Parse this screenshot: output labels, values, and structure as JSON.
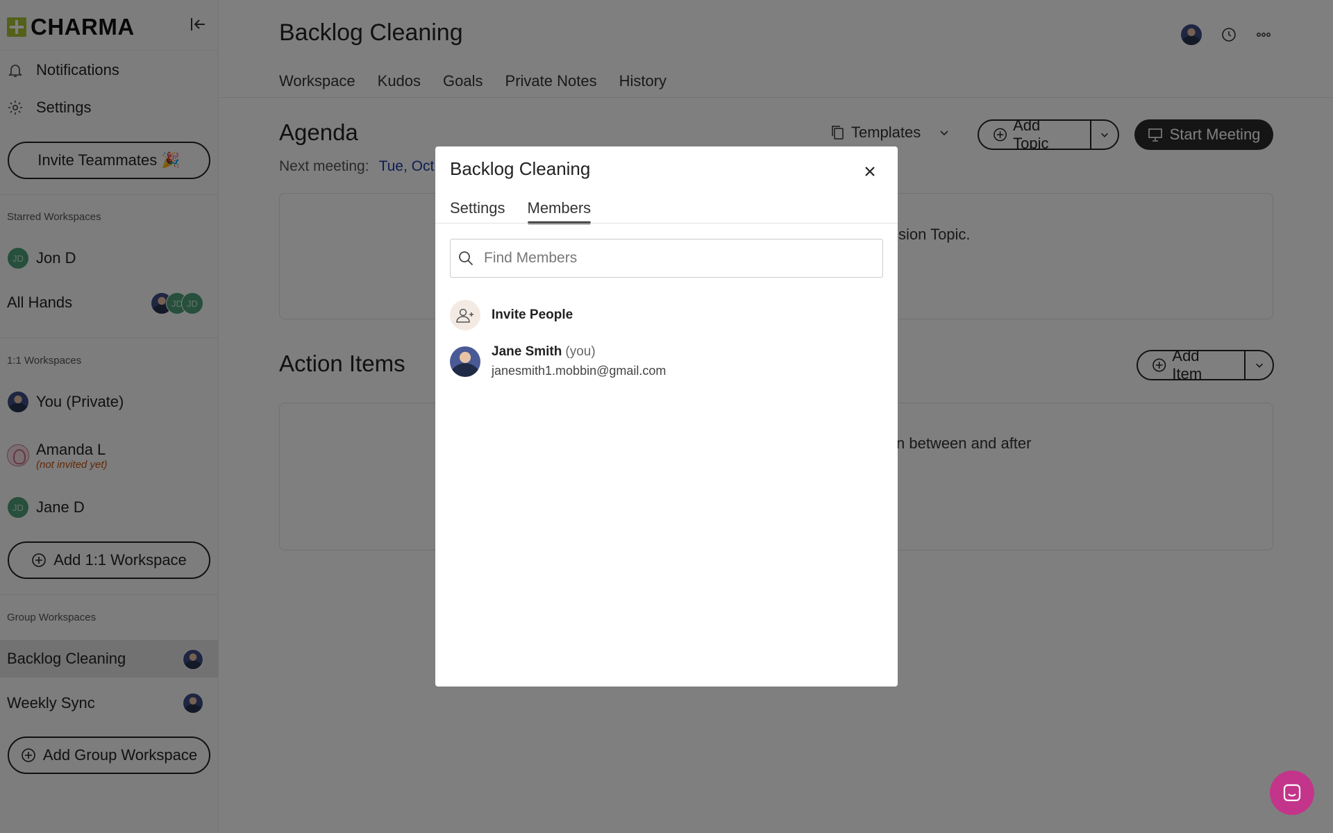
{
  "app": {
    "brand": "CHARMA"
  },
  "sidebar": {
    "nav": [
      {
        "label": "Notifications",
        "icon": "bell-icon"
      },
      {
        "label": "Settings",
        "icon": "gear-icon"
      }
    ],
    "invite_button": "Invite Teammates 🎉",
    "starred_label": "Starred Workspaces",
    "starred": [
      {
        "name": "Jon D",
        "initials": "JD"
      },
      {
        "name": "All Hands",
        "initials_a": "JD",
        "initials_b": "JD"
      }
    ],
    "one_on_one_label": "1:1 Workspaces",
    "one_on_one": [
      {
        "name": "You (Private)"
      },
      {
        "name": "Amanda L",
        "note": "(not invited yet)"
      },
      {
        "name": "Jane D",
        "initials": "JD"
      }
    ],
    "add_one_on_one": "Add 1:1 Workspace",
    "group_label": "Group Workspaces",
    "group": [
      {
        "name": "Backlog Cleaning"
      },
      {
        "name": "Weekly Sync"
      }
    ],
    "add_group": "Add Group Workspace"
  },
  "header": {
    "title": "Backlog Cleaning",
    "tabs": [
      "Workspace",
      "Kudos",
      "Goals",
      "Private Notes",
      "History"
    ]
  },
  "agenda": {
    "title": "Agenda",
    "templates": "Templates",
    "add_topic": "Add Topic",
    "start_meeting": "Start Meeting",
    "next_meeting_label": "Next meeting:",
    "next_meeting_value": "Tue, Oct",
    "card_text": "ssion Topic."
  },
  "action_items": {
    "title": "Action Items",
    "add_item": "Add Item",
    "card_text": "n between and after"
  },
  "modal": {
    "title": "Backlog Cleaning",
    "tabs": [
      "Settings",
      "Members"
    ],
    "active_tab": "Members",
    "search_placeholder": "Find Members",
    "invite_label": "Invite People",
    "members": [
      {
        "name": "Jane Smith",
        "tag": "(you)",
        "email": "janesmith1.mobbin@gmail.com"
      }
    ]
  },
  "colors": {
    "accent": "#a7c335",
    "chat": "#c3358a",
    "link": "#1e3ca8",
    "warning": "#c9500b"
  }
}
